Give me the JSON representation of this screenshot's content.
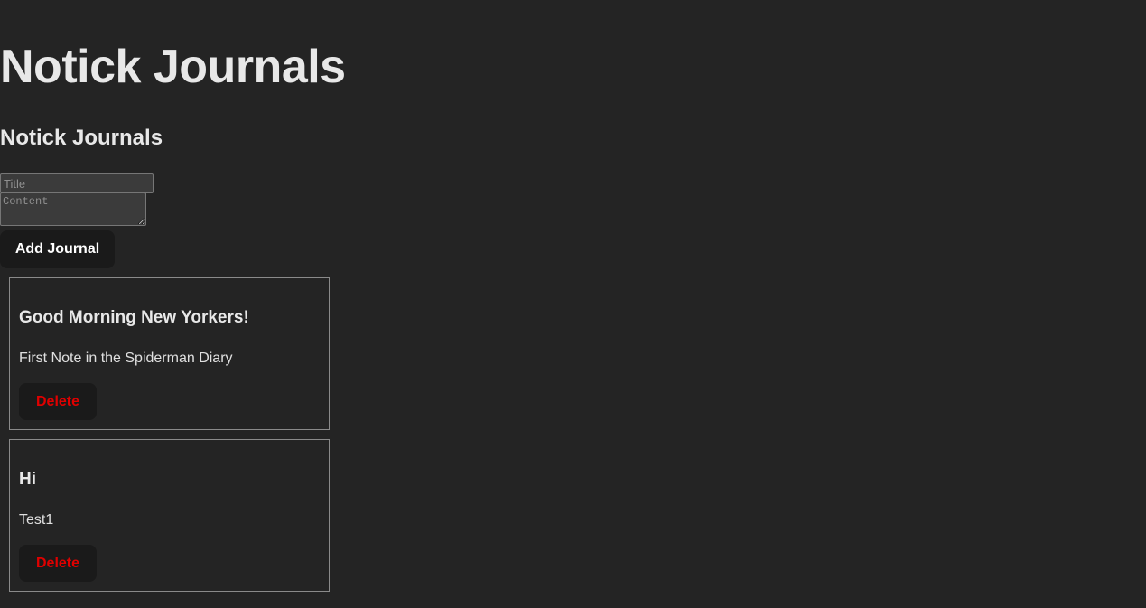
{
  "header": {
    "title": "Notick Journals",
    "subtitle": "Notick Journals"
  },
  "form": {
    "title_placeholder": "Title",
    "title_value": "",
    "content_placeholder": "Content",
    "content_value": "",
    "add_button_label": "Add Journal"
  },
  "journals": [
    {
      "title": "Good Morning New Yorkers!",
      "content": "First Note in the Spiderman Diary",
      "delete_label": "Delete"
    },
    {
      "title": "Hi",
      "content": "Test1",
      "delete_label": "Delete"
    }
  ],
  "colors": {
    "background": "#242424",
    "text": "#e6e6e6",
    "button_background": "#1a1a1a",
    "delete_text": "#e00000",
    "card_border": "#8a8a8a"
  }
}
